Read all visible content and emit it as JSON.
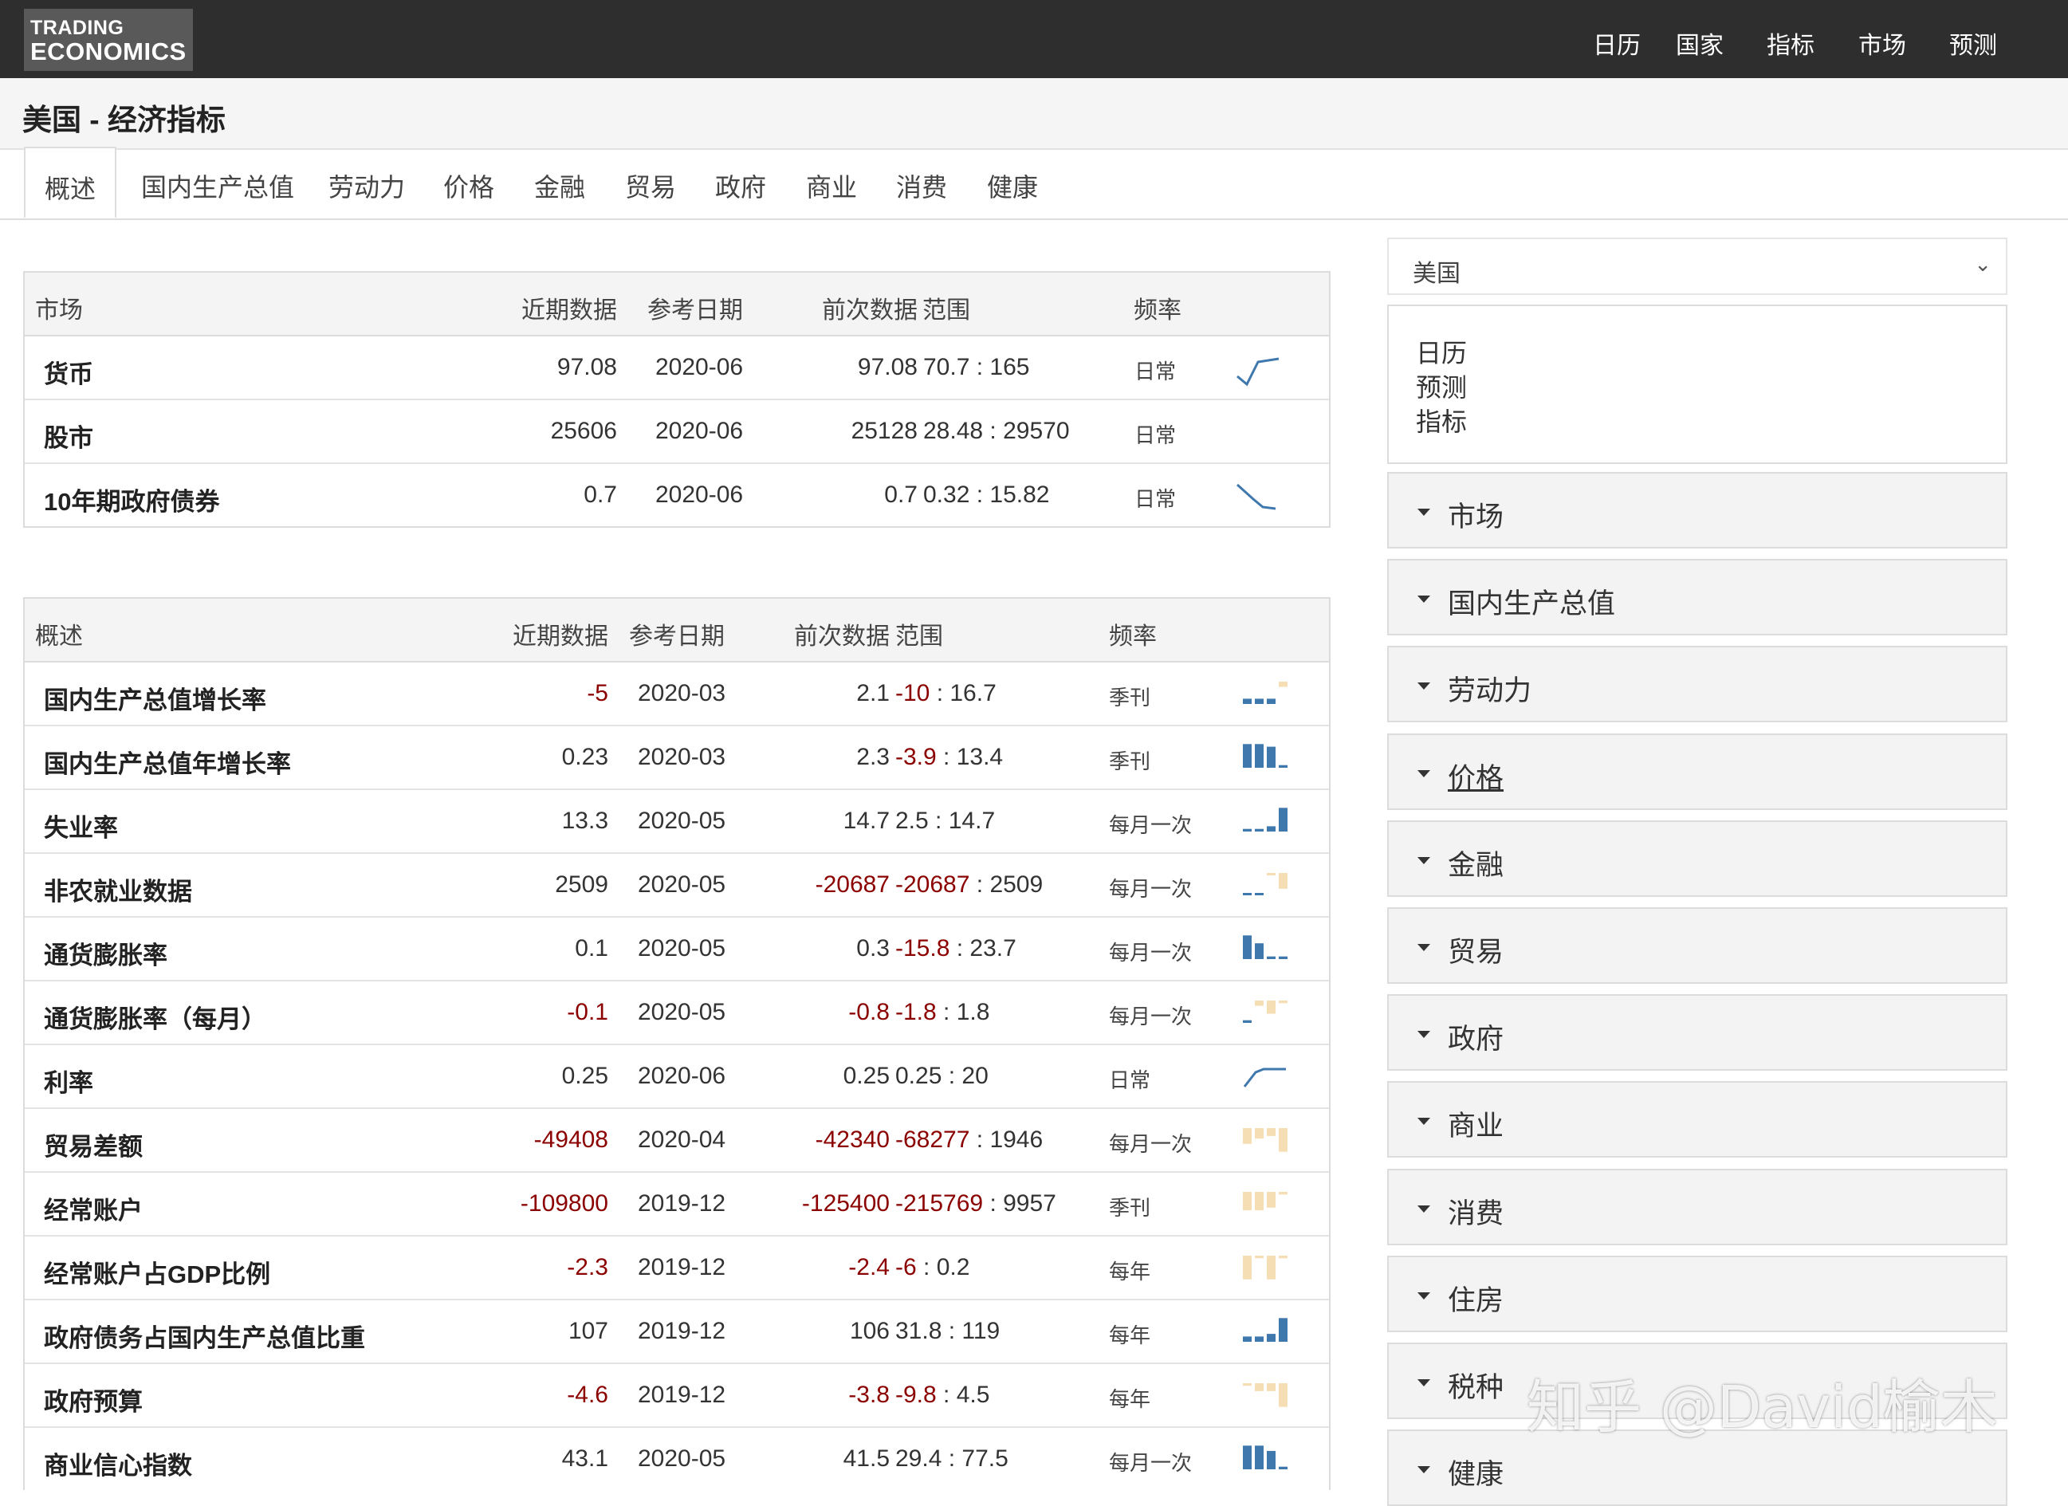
{
  "brand": {
    "line1": "TRADING",
    "line2": "ECONOMICS"
  },
  "nav": [
    "日历",
    "国家",
    "指标",
    "市场",
    "预测"
  ],
  "page_title": "美国 - 经济指标",
  "tabs": [
    "概述",
    "国内生产总值",
    "劳动力",
    "价格",
    "金融",
    "贸易",
    "政府",
    "商业",
    "消费",
    "健康"
  ],
  "markets_table": {
    "headers": {
      "name": "市场",
      "latest": "近期数据",
      "ref": "参考日期",
      "prev": "前次数据",
      "range": "范围",
      "freq": "频率"
    },
    "rows": [
      {
        "name": "货币",
        "latest": "97.08",
        "ref": "2020-06",
        "prev": "97.08",
        "range_lo": "70.7",
        "range_hi": "165",
        "freq": "日常",
        "spark": "line-up"
      },
      {
        "name": "股市",
        "latest": "25606",
        "ref": "2020-06",
        "prev": "25128",
        "range_lo": "28.48",
        "range_hi": "29570",
        "freq": "日常",
        "spark": "none"
      },
      {
        "name": "10年期政府债券",
        "latest": "0.7",
        "ref": "2020-06",
        "prev": "0.7",
        "range_lo": "0.32",
        "range_hi": "15.82",
        "freq": "日常",
        "spark": "line-down"
      }
    ]
  },
  "overview_table": {
    "headers": {
      "name": "概述",
      "latest": "近期数据",
      "ref": "参考日期",
      "prev": "前次数据",
      "range": "范围",
      "freq": "频率"
    },
    "rows": [
      {
        "name": "国内生产总值增长率",
        "latest": "-5",
        "ref": "2020-03",
        "prev": "2.1",
        "range_lo": "-10",
        "range_hi": "16.7",
        "freq": "季刊",
        "spark": "bars",
        "bars": [
          2,
          2,
          2,
          -2
        ]
      },
      {
        "name": "国内生产总值年增长率",
        "latest": "0.23",
        "ref": "2020-03",
        "prev": "2.3",
        "range_lo": "-3.9",
        "range_hi": "13.4",
        "freq": "季刊",
        "spark": "bars",
        "bars": [
          9,
          9,
          8,
          1
        ]
      },
      {
        "name": "失业率",
        "latest": "13.3",
        "ref": "2020-05",
        "prev": "14.7",
        "range_lo": "2.5",
        "range_hi": "14.7",
        "freq": "每月一次",
        "spark": "bars",
        "bars": [
          1,
          1,
          2,
          9
        ]
      },
      {
        "name": "非农就业数据",
        "latest": "2509",
        "ref": "2020-05",
        "prev": "-20687",
        "range_lo": "-20687",
        "range_hi": "2509",
        "freq": "每月一次",
        "spark": "bars",
        "bars": [
          0.5,
          0.5,
          -0.5,
          -6
        ]
      },
      {
        "name": "通货膨胀率",
        "latest": "0.1",
        "ref": "2020-05",
        "prev": "0.3",
        "range_lo": "-15.8",
        "range_hi": "23.7",
        "freq": "每月一次",
        "spark": "bars",
        "bars": [
          9,
          6,
          1,
          1
        ]
      },
      {
        "name": "通货膨胀率（每月）",
        "latest": "-0.1",
        "ref": "2020-05",
        "prev": "-0.8",
        "range_lo": "-1.8",
        "range_hi": "1.8",
        "freq": "每月一次",
        "spark": "bars",
        "bars": [
          1,
          -2,
          -5,
          -1
        ]
      },
      {
        "name": "利率",
        "latest": "0.25",
        "ref": "2020-06",
        "prev": "0.25",
        "range_lo": "0.25",
        "range_hi": "20",
        "freq": "日常",
        "spark": "line-flat"
      },
      {
        "name": "贸易差额",
        "latest": "-49408",
        "ref": "2020-04",
        "prev": "-42340",
        "range_lo": "-68277",
        "range_hi": "1946",
        "freq": "每月一次",
        "spark": "bars",
        "bars": [
          -6,
          -4,
          -3,
          -9
        ]
      },
      {
        "name": "经常账户",
        "latest": "-109800",
        "ref": "2019-12",
        "prev": "-125400",
        "range_lo": "-215769",
        "range_hi": "9957",
        "freq": "季刊",
        "spark": "bars",
        "bars": [
          -7,
          -7,
          -6,
          -1
        ]
      },
      {
        "name": "经常账户占GDP比例",
        "latest": "-2.3",
        "ref": "2019-12",
        "prev": "-2.4",
        "range_lo": "-6",
        "range_hi": "0.2",
        "freq": "每年",
        "spark": "bars",
        "bars": [
          -9,
          -1,
          -9,
          -1
        ]
      },
      {
        "name": "政府债务占国内生产总值比重",
        "latest": "107",
        "ref": "2019-12",
        "prev": "106",
        "range_lo": "31.8",
        "range_hi": "119",
        "freq": "每年",
        "spark": "bars",
        "bars": [
          2,
          2,
          3,
          9
        ]
      },
      {
        "name": "政府预算",
        "latest": "-4.6",
        "ref": "2019-12",
        "prev": "-3.8",
        "range_lo": "-9.8",
        "range_hi": "4.5",
        "freq": "每年",
        "spark": "bars",
        "bars": [
          -1,
          -3,
          -3,
          -9
        ]
      },
      {
        "name": "商业信心指数",
        "latest": "43.1",
        "ref": "2020-05",
        "prev": "41.5",
        "range_lo": "29.4",
        "range_hi": "77.5",
        "freq": "每月一次",
        "spark": "bars",
        "bars": [
          9,
          9,
          7,
          1
        ]
      }
    ]
  },
  "sidebar": {
    "country_select": "美国",
    "links": [
      "日历",
      "预测",
      "指标"
    ],
    "sections": [
      "市场",
      "国内生产总值",
      "劳动力",
      "价格",
      "金融",
      "贸易",
      "政府",
      "商业",
      "消费",
      "住房",
      "税种",
      "健康"
    ]
  },
  "colors": {
    "positive": "#3f78ad",
    "negative": "#f5deb3",
    "neg_text": "#8b0000",
    "topbar": "#2e2e2e"
  },
  "watermark": "知乎 @David榆木"
}
